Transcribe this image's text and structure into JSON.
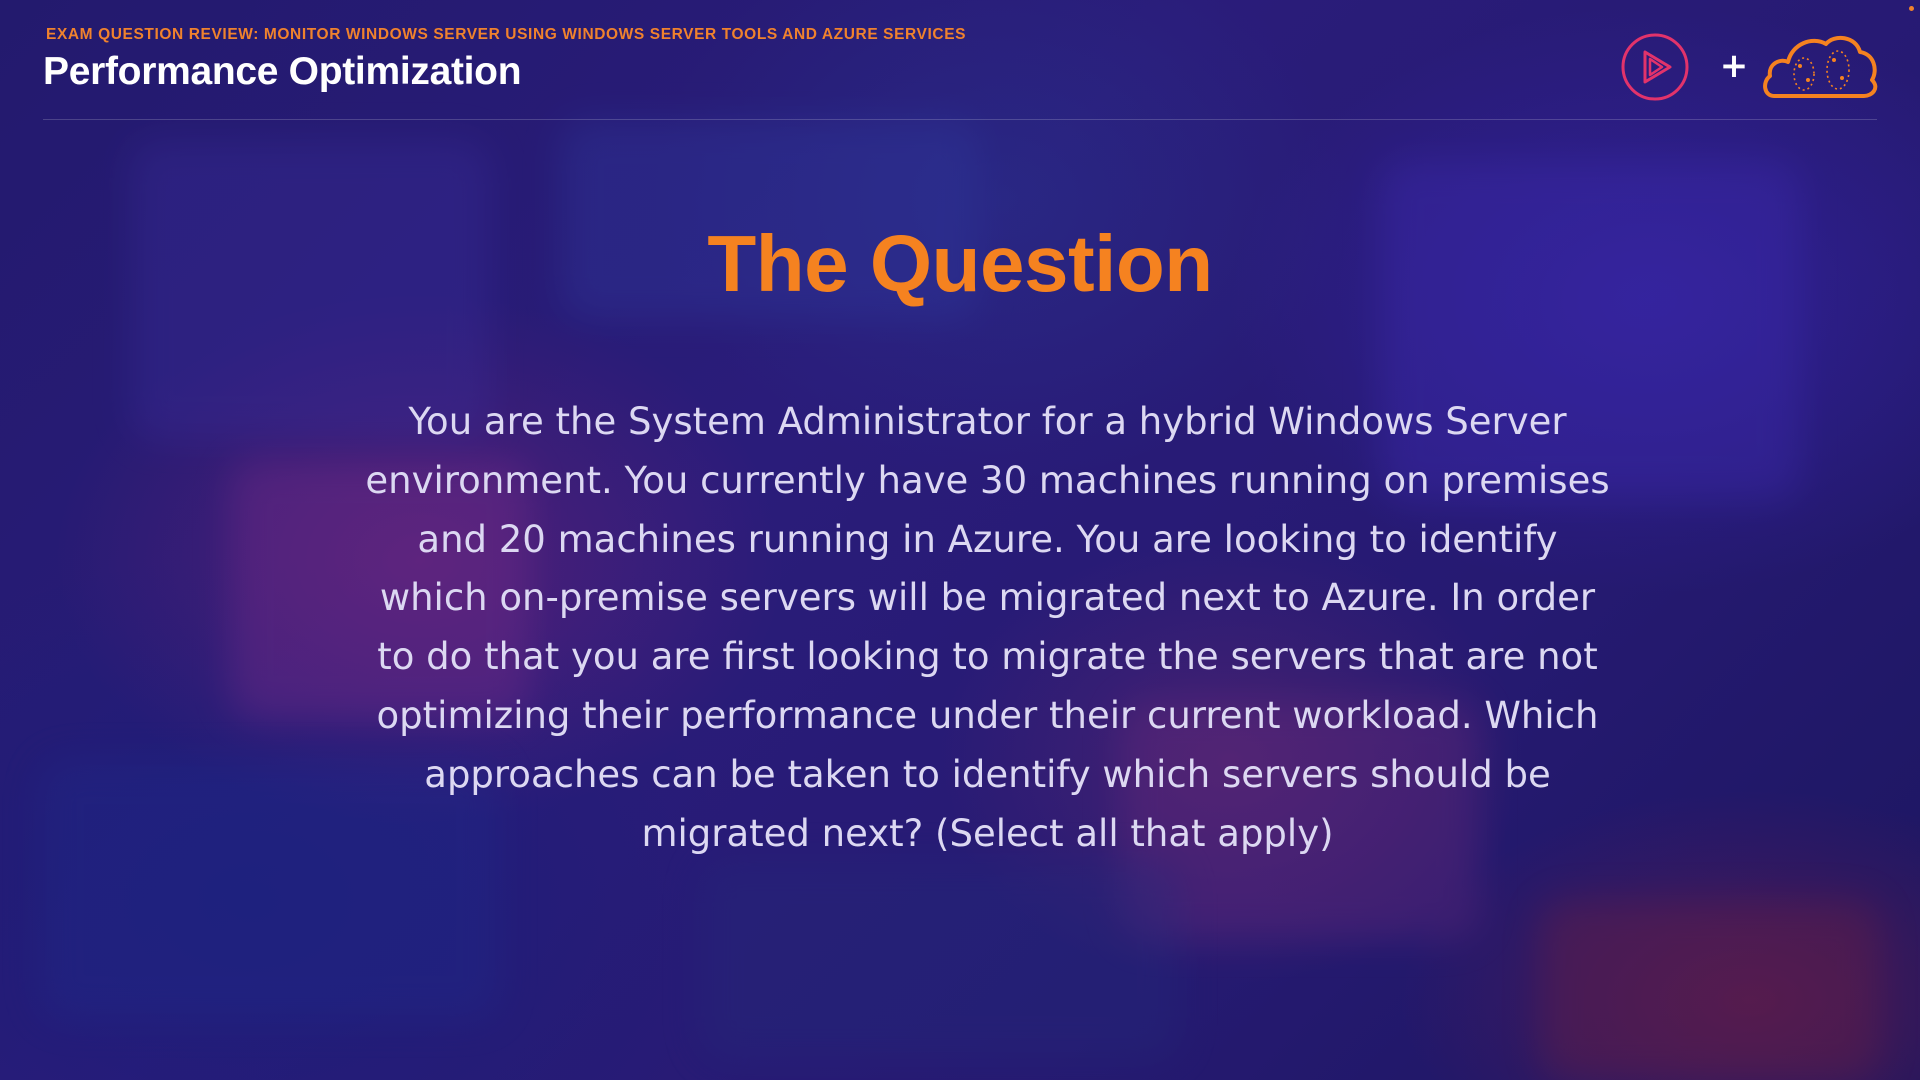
{
  "header": {
    "eyebrow": "EXAM QUESTION REVIEW: MONITOR WINDOWS SERVER USING WINDOWS SERVER TOOLS AND AZURE SERVICES",
    "title": "Performance Optimization"
  },
  "logos": {
    "left_icon": "play-icon",
    "separator": "+",
    "right_icon": "cloud-icon"
  },
  "main": {
    "heading": "The Question",
    "question": "You are the System Administrator for a hybrid Windows Server environment. You currently have 30 machines running on premises and 20 machines running in Azure. You are looking to identify which on-premise servers will be migrated next to Azure. In order to do that you are first looking to migrate the servers that are not optimizing their performance under their current workload. Which approaches can be taken to identify which servers should be migrated next? (Select all that apply)"
  },
  "colors": {
    "accent_orange": "#f58220",
    "play_logo_pink": "#e2336b",
    "background_purple": "#261a72",
    "body_text": "#dcd8f2"
  }
}
